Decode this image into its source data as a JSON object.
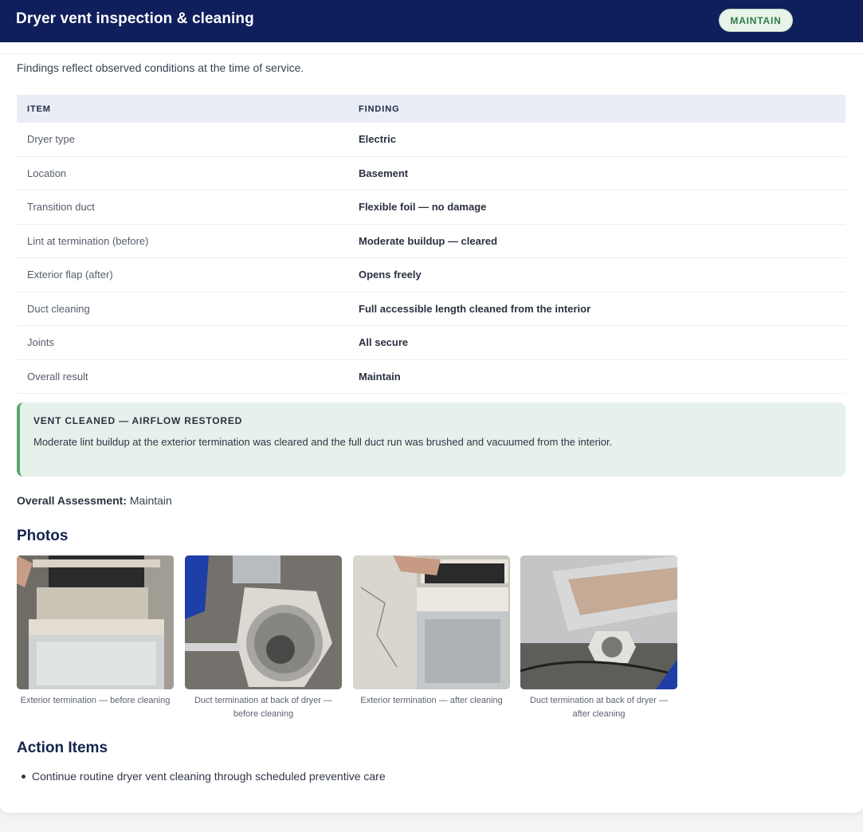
{
  "header": {
    "title": "Dryer vent inspection & cleaning",
    "badge": "MAINTAIN"
  },
  "intro": "Findings reflect observed conditions at the time of service.",
  "table": {
    "headers": [
      "ITEM",
      "FINDING"
    ],
    "rows": [
      {
        "item": "Dryer type",
        "finding": "Electric"
      },
      {
        "item": "Location",
        "finding": "Basement"
      },
      {
        "item": "Transition duct",
        "finding": "Flexible foil — no damage"
      },
      {
        "item": "Lint at termination (before)",
        "finding": "Moderate buildup — cleared"
      },
      {
        "item": "Exterior flap (after)",
        "finding": "Opens freely"
      },
      {
        "item": "Duct cleaning",
        "finding": "Full accessible length cleaned from the interior"
      },
      {
        "item": "Joints",
        "finding": "All secure"
      },
      {
        "item": "Overall result",
        "finding": "Maintain"
      }
    ]
  },
  "callout": {
    "title": "VENT CLEANED — AIRFLOW RESTORED",
    "body": "Moderate lint buildup at the exterior termination was cleared and the full duct run was brushed and vacuumed from the interior."
  },
  "assessment": {
    "label": "Overall Assessment:",
    "value": "Maintain"
  },
  "photos": {
    "title": "Photos",
    "items": [
      {
        "caption": "Exterior termination — before cleaning"
      },
      {
        "caption": "Duct termination at back of dryer — before cleaning"
      },
      {
        "caption": "Exterior termination — after cleaning"
      },
      {
        "caption": "Duct termination at back of dryer — after cleaning"
      }
    ]
  },
  "actions": {
    "title": "Action Items",
    "items": [
      "Continue routine dryer vent cleaning through scheduled preventive care"
    ]
  },
  "colors": {
    "header_bg": "#0f1f5c",
    "badge_text": "#2e7d46",
    "callout_bg": "#e5f1ea",
    "callout_accent": "#5aa56e"
  }
}
